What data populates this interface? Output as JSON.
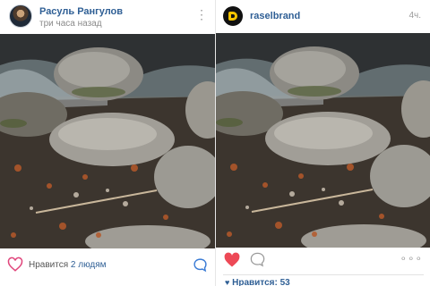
{
  "left_post": {
    "username": "Расуль Рангулов",
    "timestamp": "три часа назад",
    "menu_icon": "vertical-ellipsis-icon",
    "likes_prefix": "Нравится",
    "likes_link": "2 людям",
    "heart_color": "#e0457b",
    "comment_color": "#3a7bd5"
  },
  "right_post": {
    "username": "raselbrand",
    "timestamp": "4ч.",
    "more_icon": "horizontal-ellipsis-icon",
    "more_glyph": "∘∘∘",
    "likes_label": "Нравится: 53",
    "heart_color": "#ed4956",
    "accent_color": "#2f5f95"
  }
}
